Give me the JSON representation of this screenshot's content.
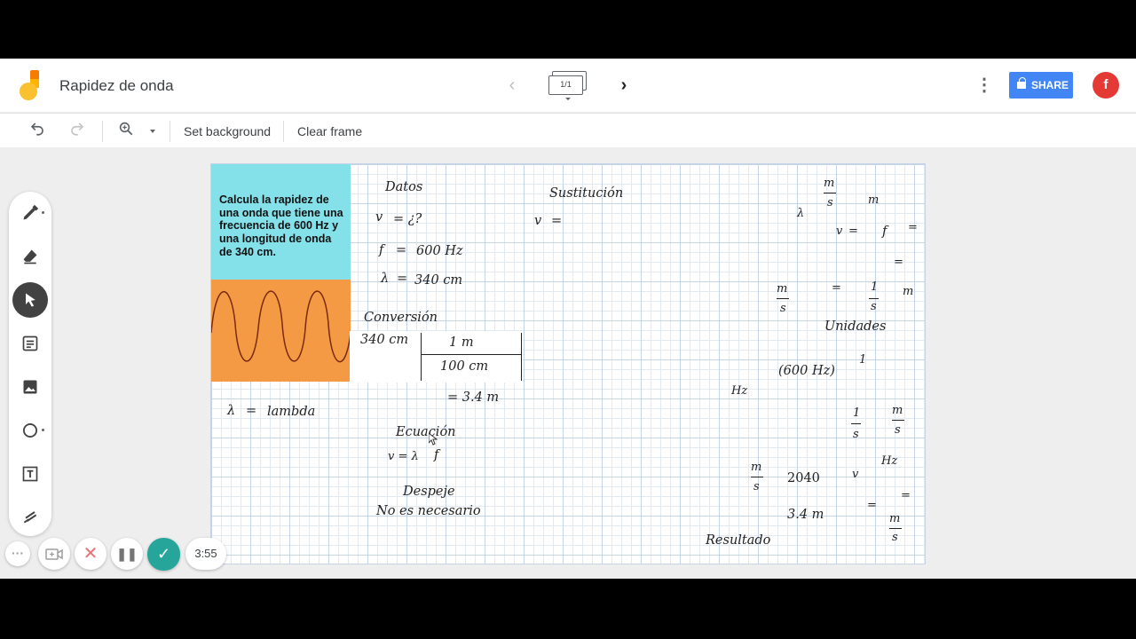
{
  "app": {
    "title": "Rapidez de onda",
    "frame_indicator": "1/1",
    "share_label": "SHARE",
    "avatar_initial": "f",
    "colors": {
      "accent": "#4285f4",
      "avatar": "#e53935",
      "done": "#26a69a"
    }
  },
  "toolbar": {
    "undo_icon": "undo-icon",
    "redo_icon": "redo-icon",
    "zoom_icon": "zoom-icon",
    "set_background": "Set background",
    "clear_frame": "Clear frame"
  },
  "tools": [
    "pen-icon",
    "eraser-icon",
    "select-icon",
    "sticky-note-icon",
    "image-icon",
    "circle-icon",
    "text-box-icon",
    "laser-icon"
  ],
  "controls": {
    "more": "···",
    "timer": "3:55"
  },
  "canvas": {
    "problem": "Calcula la rapidez de una onda que tiene una frecuencia de 600 Hz y una longitud de onda de 340 cm.",
    "card_colors": {
      "problem": "#84e1ea",
      "wave": "#f49a45"
    },
    "datos": {
      "title": "Datos",
      "v_label": "v",
      "v_value": "= ¿?",
      "f_label": "f",
      "eq": "=",
      "f_value": "600 Hz",
      "lambda_label": "λ",
      "lambda_value": "340 cm"
    },
    "lambda_def": {
      "symbol": "λ",
      "eq": "=",
      "word": "lambda"
    },
    "conversion": {
      "title": "Conversión",
      "value": "340 cm",
      "num": "1 m",
      "den": "100 cm",
      "result": "= 3.4 m"
    },
    "ecuacion": {
      "title": "Ecuación",
      "formula_left": "v = λ",
      "formula_right": "f"
    },
    "despeje": {
      "title": "Despeje",
      "note": "No es necesario"
    },
    "sustitucion": {
      "title": "Sustitución",
      "v": "v",
      "eq": "="
    },
    "unidades": {
      "title": "Unidades",
      "lambda": "λ",
      "m_top": "m",
      "s_top": "s",
      "m": "m",
      "v": "v",
      "eq": "=",
      "f": "f",
      "one": "1",
      "hz": "Hz",
      "six_hundred_hz": "(600 Hz)"
    },
    "resultado": {
      "title": "Resultado",
      "value": "2040",
      "m": "m",
      "s": "s",
      "lambda_value": "3.4 m",
      "v": "v",
      "hz": "Hz",
      "eq": "="
    }
  }
}
